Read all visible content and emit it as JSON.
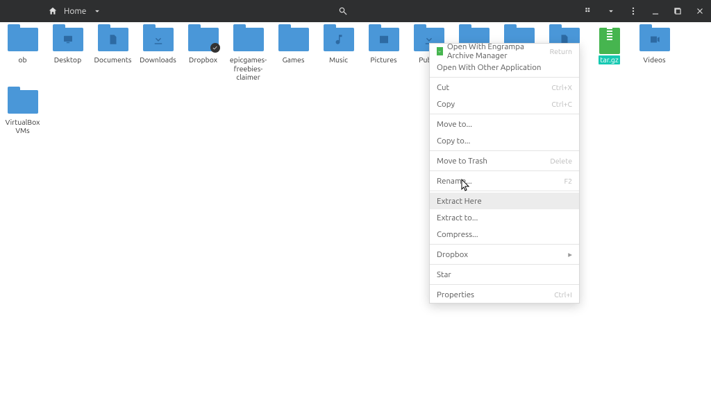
{
  "header": {
    "location": "Home"
  },
  "items": [
    {
      "label": "ob",
      "type": "folder",
      "glyph": "none"
    },
    {
      "label": "Desktop",
      "type": "folder",
      "glyph": "desktop"
    },
    {
      "label": "Documents",
      "type": "folder",
      "glyph": "doc"
    },
    {
      "label": "Downloads",
      "type": "folder",
      "glyph": "download"
    },
    {
      "label": "Dropbox",
      "type": "folder",
      "glyph": "none",
      "badge": "✓"
    },
    {
      "label": "epicgames-freebies-claimer",
      "type": "folder",
      "glyph": "none"
    },
    {
      "label": "Games",
      "type": "folder",
      "glyph": "none"
    },
    {
      "label": "Music",
      "type": "folder",
      "glyph": "music"
    },
    {
      "label": "Pictures",
      "type": "folder",
      "glyph": "picture"
    },
    {
      "label": "Public",
      "type": "folder",
      "glyph": "public"
    },
    {
      "label": "",
      "type": "folder",
      "glyph": "none"
    },
    {
      "label": "",
      "type": "folder",
      "glyph": "none"
    },
    {
      "label": "",
      "type": "folder",
      "glyph": "doc"
    },
    {
      "label": "tar.gz",
      "type": "archive",
      "selected": true
    },
    {
      "label": "Videos",
      "type": "folder",
      "glyph": "video"
    },
    {
      "label": "VirtualBox VMs",
      "type": "folder",
      "glyph": "none"
    }
  ],
  "menu": [
    {
      "kind": "item",
      "label": "Open With Engrampa Archive Manager",
      "key": "Return",
      "icon": true
    },
    {
      "kind": "item",
      "label": "Open With Other Application"
    },
    {
      "kind": "sep"
    },
    {
      "kind": "item",
      "label": "Cut",
      "key": "Ctrl+X"
    },
    {
      "kind": "item",
      "label": "Copy",
      "key": "Ctrl+C"
    },
    {
      "kind": "sep"
    },
    {
      "kind": "item",
      "label": "Move to..."
    },
    {
      "kind": "item",
      "label": "Copy to..."
    },
    {
      "kind": "sep"
    },
    {
      "kind": "item",
      "label": "Move to Trash",
      "key": "Delete"
    },
    {
      "kind": "sep"
    },
    {
      "kind": "item",
      "label": "Rename...",
      "key": "F2"
    },
    {
      "kind": "sep"
    },
    {
      "kind": "item",
      "label": "Extract Here",
      "hover": true
    },
    {
      "kind": "item",
      "label": "Extract to..."
    },
    {
      "kind": "item",
      "label": "Compress..."
    },
    {
      "kind": "sep"
    },
    {
      "kind": "item",
      "label": "Dropbox",
      "submenu": true
    },
    {
      "kind": "sep"
    },
    {
      "kind": "item",
      "label": "Star"
    },
    {
      "kind": "sep"
    },
    {
      "kind": "item",
      "label": "Properties",
      "key": "Ctrl+I"
    }
  ]
}
